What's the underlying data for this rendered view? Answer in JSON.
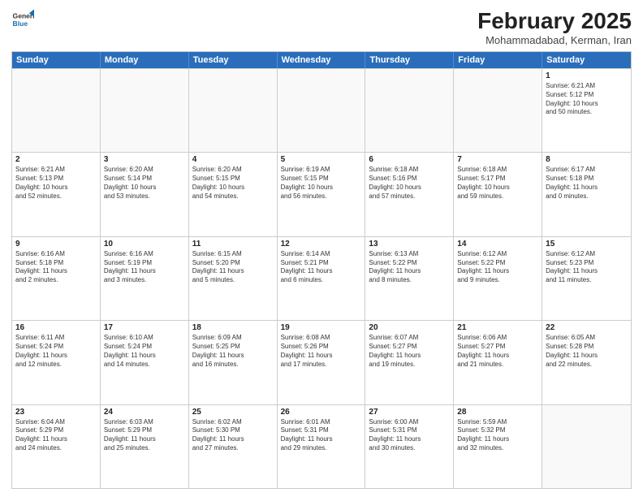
{
  "header": {
    "logo_line1": "General",
    "logo_line2": "Blue",
    "month_year": "February 2025",
    "location": "Mohammadabad, Kerman, Iran"
  },
  "days_of_week": [
    "Sunday",
    "Monday",
    "Tuesday",
    "Wednesday",
    "Thursday",
    "Friday",
    "Saturday"
  ],
  "weeks": [
    {
      "cells": [
        {
          "day": "",
          "text": ""
        },
        {
          "day": "",
          "text": ""
        },
        {
          "day": "",
          "text": ""
        },
        {
          "day": "",
          "text": ""
        },
        {
          "day": "",
          "text": ""
        },
        {
          "day": "",
          "text": ""
        },
        {
          "day": "1",
          "text": "Sunrise: 6:21 AM\nSunset: 5:12 PM\nDaylight: 10 hours\nand 50 minutes."
        }
      ]
    },
    {
      "cells": [
        {
          "day": "2",
          "text": "Sunrise: 6:21 AM\nSunset: 5:13 PM\nDaylight: 10 hours\nand 52 minutes."
        },
        {
          "day": "3",
          "text": "Sunrise: 6:20 AM\nSunset: 5:14 PM\nDaylight: 10 hours\nand 53 minutes."
        },
        {
          "day": "4",
          "text": "Sunrise: 6:20 AM\nSunset: 5:15 PM\nDaylight: 10 hours\nand 54 minutes."
        },
        {
          "day": "5",
          "text": "Sunrise: 6:19 AM\nSunset: 5:15 PM\nDaylight: 10 hours\nand 56 minutes."
        },
        {
          "day": "6",
          "text": "Sunrise: 6:18 AM\nSunset: 5:16 PM\nDaylight: 10 hours\nand 57 minutes."
        },
        {
          "day": "7",
          "text": "Sunrise: 6:18 AM\nSunset: 5:17 PM\nDaylight: 10 hours\nand 59 minutes."
        },
        {
          "day": "8",
          "text": "Sunrise: 6:17 AM\nSunset: 5:18 PM\nDaylight: 11 hours\nand 0 minutes."
        }
      ]
    },
    {
      "cells": [
        {
          "day": "9",
          "text": "Sunrise: 6:16 AM\nSunset: 5:18 PM\nDaylight: 11 hours\nand 2 minutes."
        },
        {
          "day": "10",
          "text": "Sunrise: 6:16 AM\nSunset: 5:19 PM\nDaylight: 11 hours\nand 3 minutes."
        },
        {
          "day": "11",
          "text": "Sunrise: 6:15 AM\nSunset: 5:20 PM\nDaylight: 11 hours\nand 5 minutes."
        },
        {
          "day": "12",
          "text": "Sunrise: 6:14 AM\nSunset: 5:21 PM\nDaylight: 11 hours\nand 6 minutes."
        },
        {
          "day": "13",
          "text": "Sunrise: 6:13 AM\nSunset: 5:22 PM\nDaylight: 11 hours\nand 8 minutes."
        },
        {
          "day": "14",
          "text": "Sunrise: 6:12 AM\nSunset: 5:22 PM\nDaylight: 11 hours\nand 9 minutes."
        },
        {
          "day": "15",
          "text": "Sunrise: 6:12 AM\nSunset: 5:23 PM\nDaylight: 11 hours\nand 11 minutes."
        }
      ]
    },
    {
      "cells": [
        {
          "day": "16",
          "text": "Sunrise: 6:11 AM\nSunset: 5:24 PM\nDaylight: 11 hours\nand 12 minutes."
        },
        {
          "day": "17",
          "text": "Sunrise: 6:10 AM\nSunset: 5:24 PM\nDaylight: 11 hours\nand 14 minutes."
        },
        {
          "day": "18",
          "text": "Sunrise: 6:09 AM\nSunset: 5:25 PM\nDaylight: 11 hours\nand 16 minutes."
        },
        {
          "day": "19",
          "text": "Sunrise: 6:08 AM\nSunset: 5:26 PM\nDaylight: 11 hours\nand 17 minutes."
        },
        {
          "day": "20",
          "text": "Sunrise: 6:07 AM\nSunset: 5:27 PM\nDaylight: 11 hours\nand 19 minutes."
        },
        {
          "day": "21",
          "text": "Sunrise: 6:06 AM\nSunset: 5:27 PM\nDaylight: 11 hours\nand 21 minutes."
        },
        {
          "day": "22",
          "text": "Sunrise: 6:05 AM\nSunset: 5:28 PM\nDaylight: 11 hours\nand 22 minutes."
        }
      ]
    },
    {
      "cells": [
        {
          "day": "23",
          "text": "Sunrise: 6:04 AM\nSunset: 5:29 PM\nDaylight: 11 hours\nand 24 minutes."
        },
        {
          "day": "24",
          "text": "Sunrise: 6:03 AM\nSunset: 5:29 PM\nDaylight: 11 hours\nand 25 minutes."
        },
        {
          "day": "25",
          "text": "Sunrise: 6:02 AM\nSunset: 5:30 PM\nDaylight: 11 hours\nand 27 minutes."
        },
        {
          "day": "26",
          "text": "Sunrise: 6:01 AM\nSunset: 5:31 PM\nDaylight: 11 hours\nand 29 minutes."
        },
        {
          "day": "27",
          "text": "Sunrise: 6:00 AM\nSunset: 5:31 PM\nDaylight: 11 hours\nand 30 minutes."
        },
        {
          "day": "28",
          "text": "Sunrise: 5:59 AM\nSunset: 5:32 PM\nDaylight: 11 hours\nand 32 minutes."
        },
        {
          "day": "",
          "text": ""
        }
      ]
    }
  ]
}
